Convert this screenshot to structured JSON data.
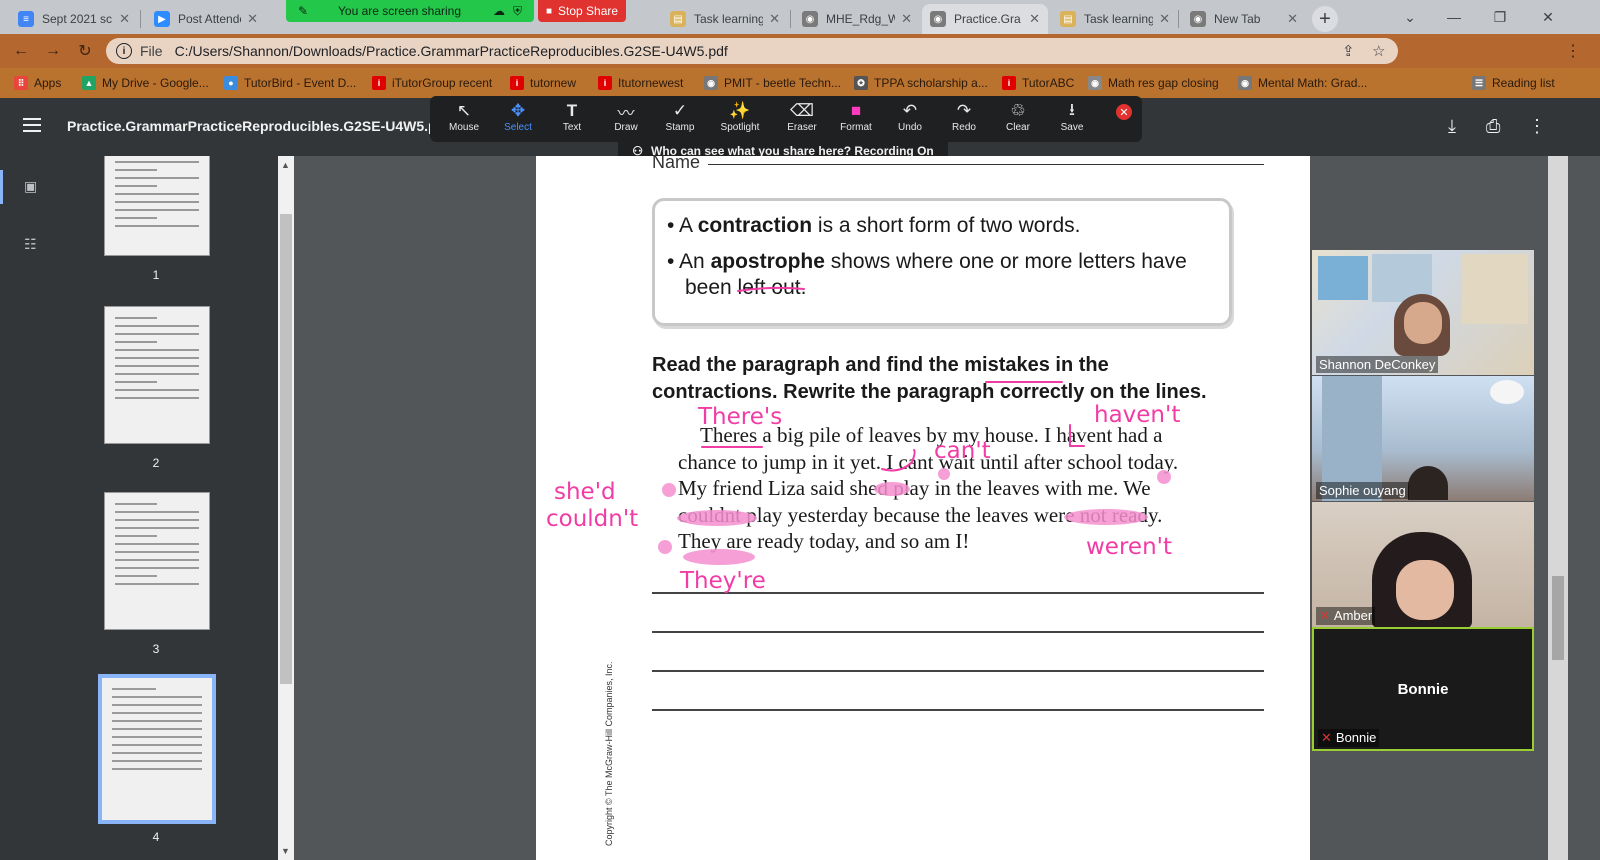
{
  "tabs": [
    {
      "title": "Sept 2021 sc",
      "fav_color": "#4285f4"
    },
    {
      "title": "Post Attende",
      "fav_color": "#2d8cff"
    },
    {
      "title": "Task learning",
      "fav_color": "#d9b25a"
    },
    {
      "title": "MHE_Rdg_W",
      "fav_color": "#7a7a7a"
    },
    {
      "title": "Practice.Gra",
      "fav_color": "#7a7a7a",
      "active": true
    },
    {
      "title": "Task learning",
      "fav_color": "#d9b25a"
    },
    {
      "title": "New Tab",
      "fav_color": "#7a7a7a"
    }
  ],
  "share_banner": "You are screen sharing",
  "stop_share": "Stop Share",
  "address": {
    "scheme": "File",
    "url": "C:/Users/Shannon/Downloads/Practice.GrammarPracticeReproducibles.G2SE-U4W5.pdf"
  },
  "bookmarks": [
    {
      "label": "Apps",
      "color": "#e8453c"
    },
    {
      "label": "My Drive - Google...",
      "color": "#1fa463"
    },
    {
      "label": "TutorBird - Event D...",
      "color": "#3a8dde"
    },
    {
      "label": "iTutorGroup recent",
      "color": "#e00000"
    },
    {
      "label": "tutornew",
      "color": "#e00000"
    },
    {
      "label": "Itutornewest",
      "color": "#e00000"
    },
    {
      "label": "PMIT - beetle Techn...",
      "color": "#777777"
    },
    {
      "label": "TPPA scholarship a...",
      "color": "#555555"
    },
    {
      "label": "TutorABC",
      "color": "#e00000"
    },
    {
      "label": "Math res gap closing",
      "color": "#888888"
    },
    {
      "label": "Mental Math: Grad...",
      "color": "#777777"
    },
    {
      "label": "Reading list",
      "color": "#777777"
    }
  ],
  "pdf": {
    "title": "Practice.GrammarPracticeReproducibles.G2SE-U4W5.pdf",
    "thumb_numbers": [
      "1",
      "2",
      "3",
      "4"
    ]
  },
  "annotate_tools": [
    {
      "label": "Mouse",
      "icon": "↖"
    },
    {
      "label": "Select",
      "icon": "✥",
      "selected": true
    },
    {
      "label": "Text",
      "icon": "T"
    },
    {
      "label": "Draw",
      "icon": "〰"
    },
    {
      "label": "Stamp",
      "icon": "✓"
    },
    {
      "label": "Spotlight",
      "icon": "✨"
    },
    {
      "label": "Eraser",
      "icon": "⌫"
    },
    {
      "label": "Format",
      "icon": "■"
    },
    {
      "label": "Undo",
      "icon": "↶"
    },
    {
      "label": "Redo",
      "icon": "↷"
    },
    {
      "label": "Clear",
      "icon": "♲"
    },
    {
      "label": "Save",
      "icon": "⭳"
    }
  ],
  "recording_banner": "Who can see what you share here? Recording On",
  "page": {
    "name_label": "Name",
    "bullet1_pre": "A ",
    "bullet1_bold": "contraction",
    "bullet1_post": " is a short form of two words.",
    "bullet2_pre": "An ",
    "bullet2_bold": "apostrophe",
    "bullet2_post": " shows where one or more letters have",
    "bullet2_cont": "been left out.",
    "instructions_line1": "Read the paragraph and find the mistakes in the",
    "instructions_line2": "contractions. Rewrite the paragraph correctly on the lines.",
    "paragraph": [
      "Theres a big pile of leaves by my house. I havent had a",
      "chance to jump in it yet. I cant wait until after school today.",
      "My friend Liza said shed play in the leaves with me. We",
      "couldnt play yesterday because the leaves were not ready.",
      "They are ready today, and so am I!"
    ],
    "copyright": "Copyright © The McGraw-Hill Companies, Inc."
  },
  "ink": {
    "theres": "There's",
    "havent": "haven't",
    "cant": "can't",
    "shed": "she'd",
    "couldnt": "couldn't",
    "werent": "weren't",
    "theyre": "They're",
    "color": "#f03ca4"
  },
  "participants": [
    {
      "name": "Shannon DeConkey",
      "muted": false
    },
    {
      "name": "Sophie ouyang",
      "muted": false
    },
    {
      "name": "Amber",
      "muted": true
    },
    {
      "name": "Bonnie",
      "muted": true,
      "display_name": "Bonnie"
    }
  ]
}
